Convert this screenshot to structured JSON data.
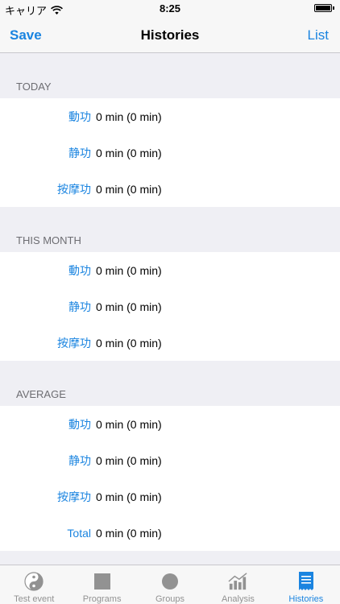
{
  "statusbar": {
    "carrier": "キャリア",
    "time": "8:25"
  },
  "navbar": {
    "left": "Save",
    "title": "Histories",
    "right": "List"
  },
  "sections": [
    {
      "header": "TODAY",
      "rows": [
        {
          "label": "動功",
          "value": "0 min (0 min)"
        },
        {
          "label": "静功",
          "value": "0 min (0 min)"
        },
        {
          "label": "按摩功",
          "value": "0 min (0 min)"
        }
      ]
    },
    {
      "header": "THIS MONTH",
      "rows": [
        {
          "label": "動功",
          "value": "0 min (0 min)"
        },
        {
          "label": "静功",
          "value": "0 min (0 min)"
        },
        {
          "label": "按摩功",
          "value": "0 min (0 min)"
        }
      ]
    },
    {
      "header": "AVERAGE",
      "rows": [
        {
          "label": "動功",
          "value": "0 min (0 min)"
        },
        {
          "label": "静功",
          "value": "0 min (0 min)"
        },
        {
          "label": "按摩功",
          "value": "0 min (0 min)"
        },
        {
          "label": "Total",
          "value": "0 min (0 min)"
        }
      ]
    }
  ],
  "tabbar": {
    "tabs": [
      {
        "label": "Test event",
        "icon": "yin-yang-icon",
        "active": false
      },
      {
        "label": "Programs",
        "icon": "square-icon",
        "active": false
      },
      {
        "label": "Groups",
        "icon": "circle-icon",
        "active": false
      },
      {
        "label": "Analysis",
        "icon": "bar-chart-icon",
        "active": false
      },
      {
        "label": "Histories",
        "icon": "receipt-icon",
        "active": true
      }
    ]
  },
  "colors": {
    "accent": "#1a84e0",
    "background": "#efeff4",
    "inactive": "#929292"
  }
}
